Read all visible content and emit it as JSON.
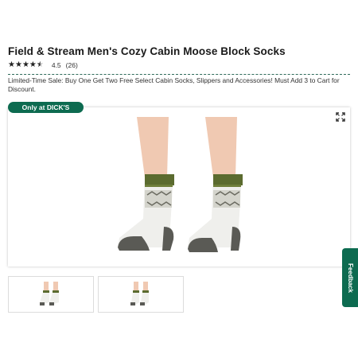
{
  "product": {
    "title": "Field & Stream Men's Cozy Cabin Moose Block Socks",
    "rating": {
      "value": "4.5",
      "count": "(26)",
      "stars": 4.5
    },
    "promo": "Limited-Time Sale: Buy One Get Two Free Select Cabin Socks, Slippers and Accessories! Must Add 3 to Cart for Discount.",
    "badge": "Only at DICK'S"
  },
  "gallery": {
    "thumbnails": [
      "thumbnail-1",
      "thumbnail-2"
    ],
    "icons": {
      "expand": "expand-icon"
    }
  },
  "feedback": {
    "label": "Feedback"
  },
  "colors": {
    "brand_green": "#0d6b50",
    "sock_cuff": "#5b6b2f",
    "sock_toe": "#5a5a55",
    "sock_body": "#efefec"
  }
}
